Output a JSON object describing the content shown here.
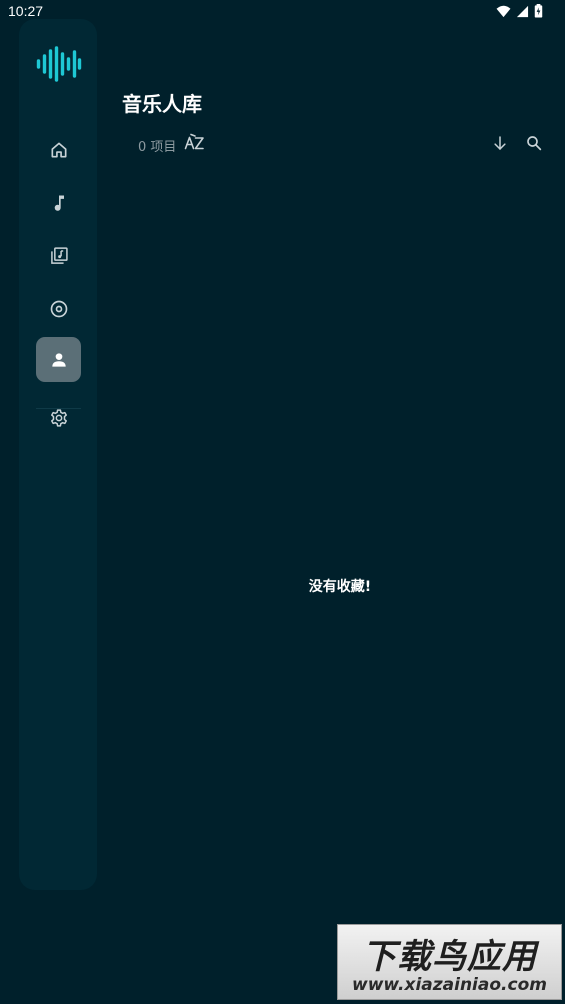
{
  "status_bar": {
    "time": "10:27",
    "icons": [
      "wifi-icon",
      "signal-icon",
      "battery-icon"
    ]
  },
  "nav_rail": {
    "logo": "waveform-logo",
    "items": [
      {
        "name": "home",
        "icon": "home-icon",
        "active": false
      },
      {
        "name": "songs",
        "icon": "music-note-icon",
        "active": false
      },
      {
        "name": "albums",
        "icon": "album-library-icon",
        "active": false
      },
      {
        "name": "discs",
        "icon": "disc-icon",
        "active": false
      },
      {
        "name": "artists",
        "icon": "person-icon",
        "active": true
      },
      {
        "name": "settings",
        "icon": "gear-icon",
        "active": false
      }
    ]
  },
  "header": {
    "title": "音乐人库",
    "count": "0 项目",
    "sort_icon": "sort-az-icon",
    "actions": [
      "arrow-down-icon",
      "search-icon"
    ]
  },
  "empty_state": {
    "message": "没有收藏!"
  },
  "watermark": {
    "title": "下载鸟应用",
    "url": "www.xiazainiao.com"
  },
  "colors": {
    "background": "#00202b",
    "rail": "#012834",
    "active_item": "#5b6f77",
    "accent": "#1ec8d4",
    "muted_text": "#8c9aa0"
  }
}
